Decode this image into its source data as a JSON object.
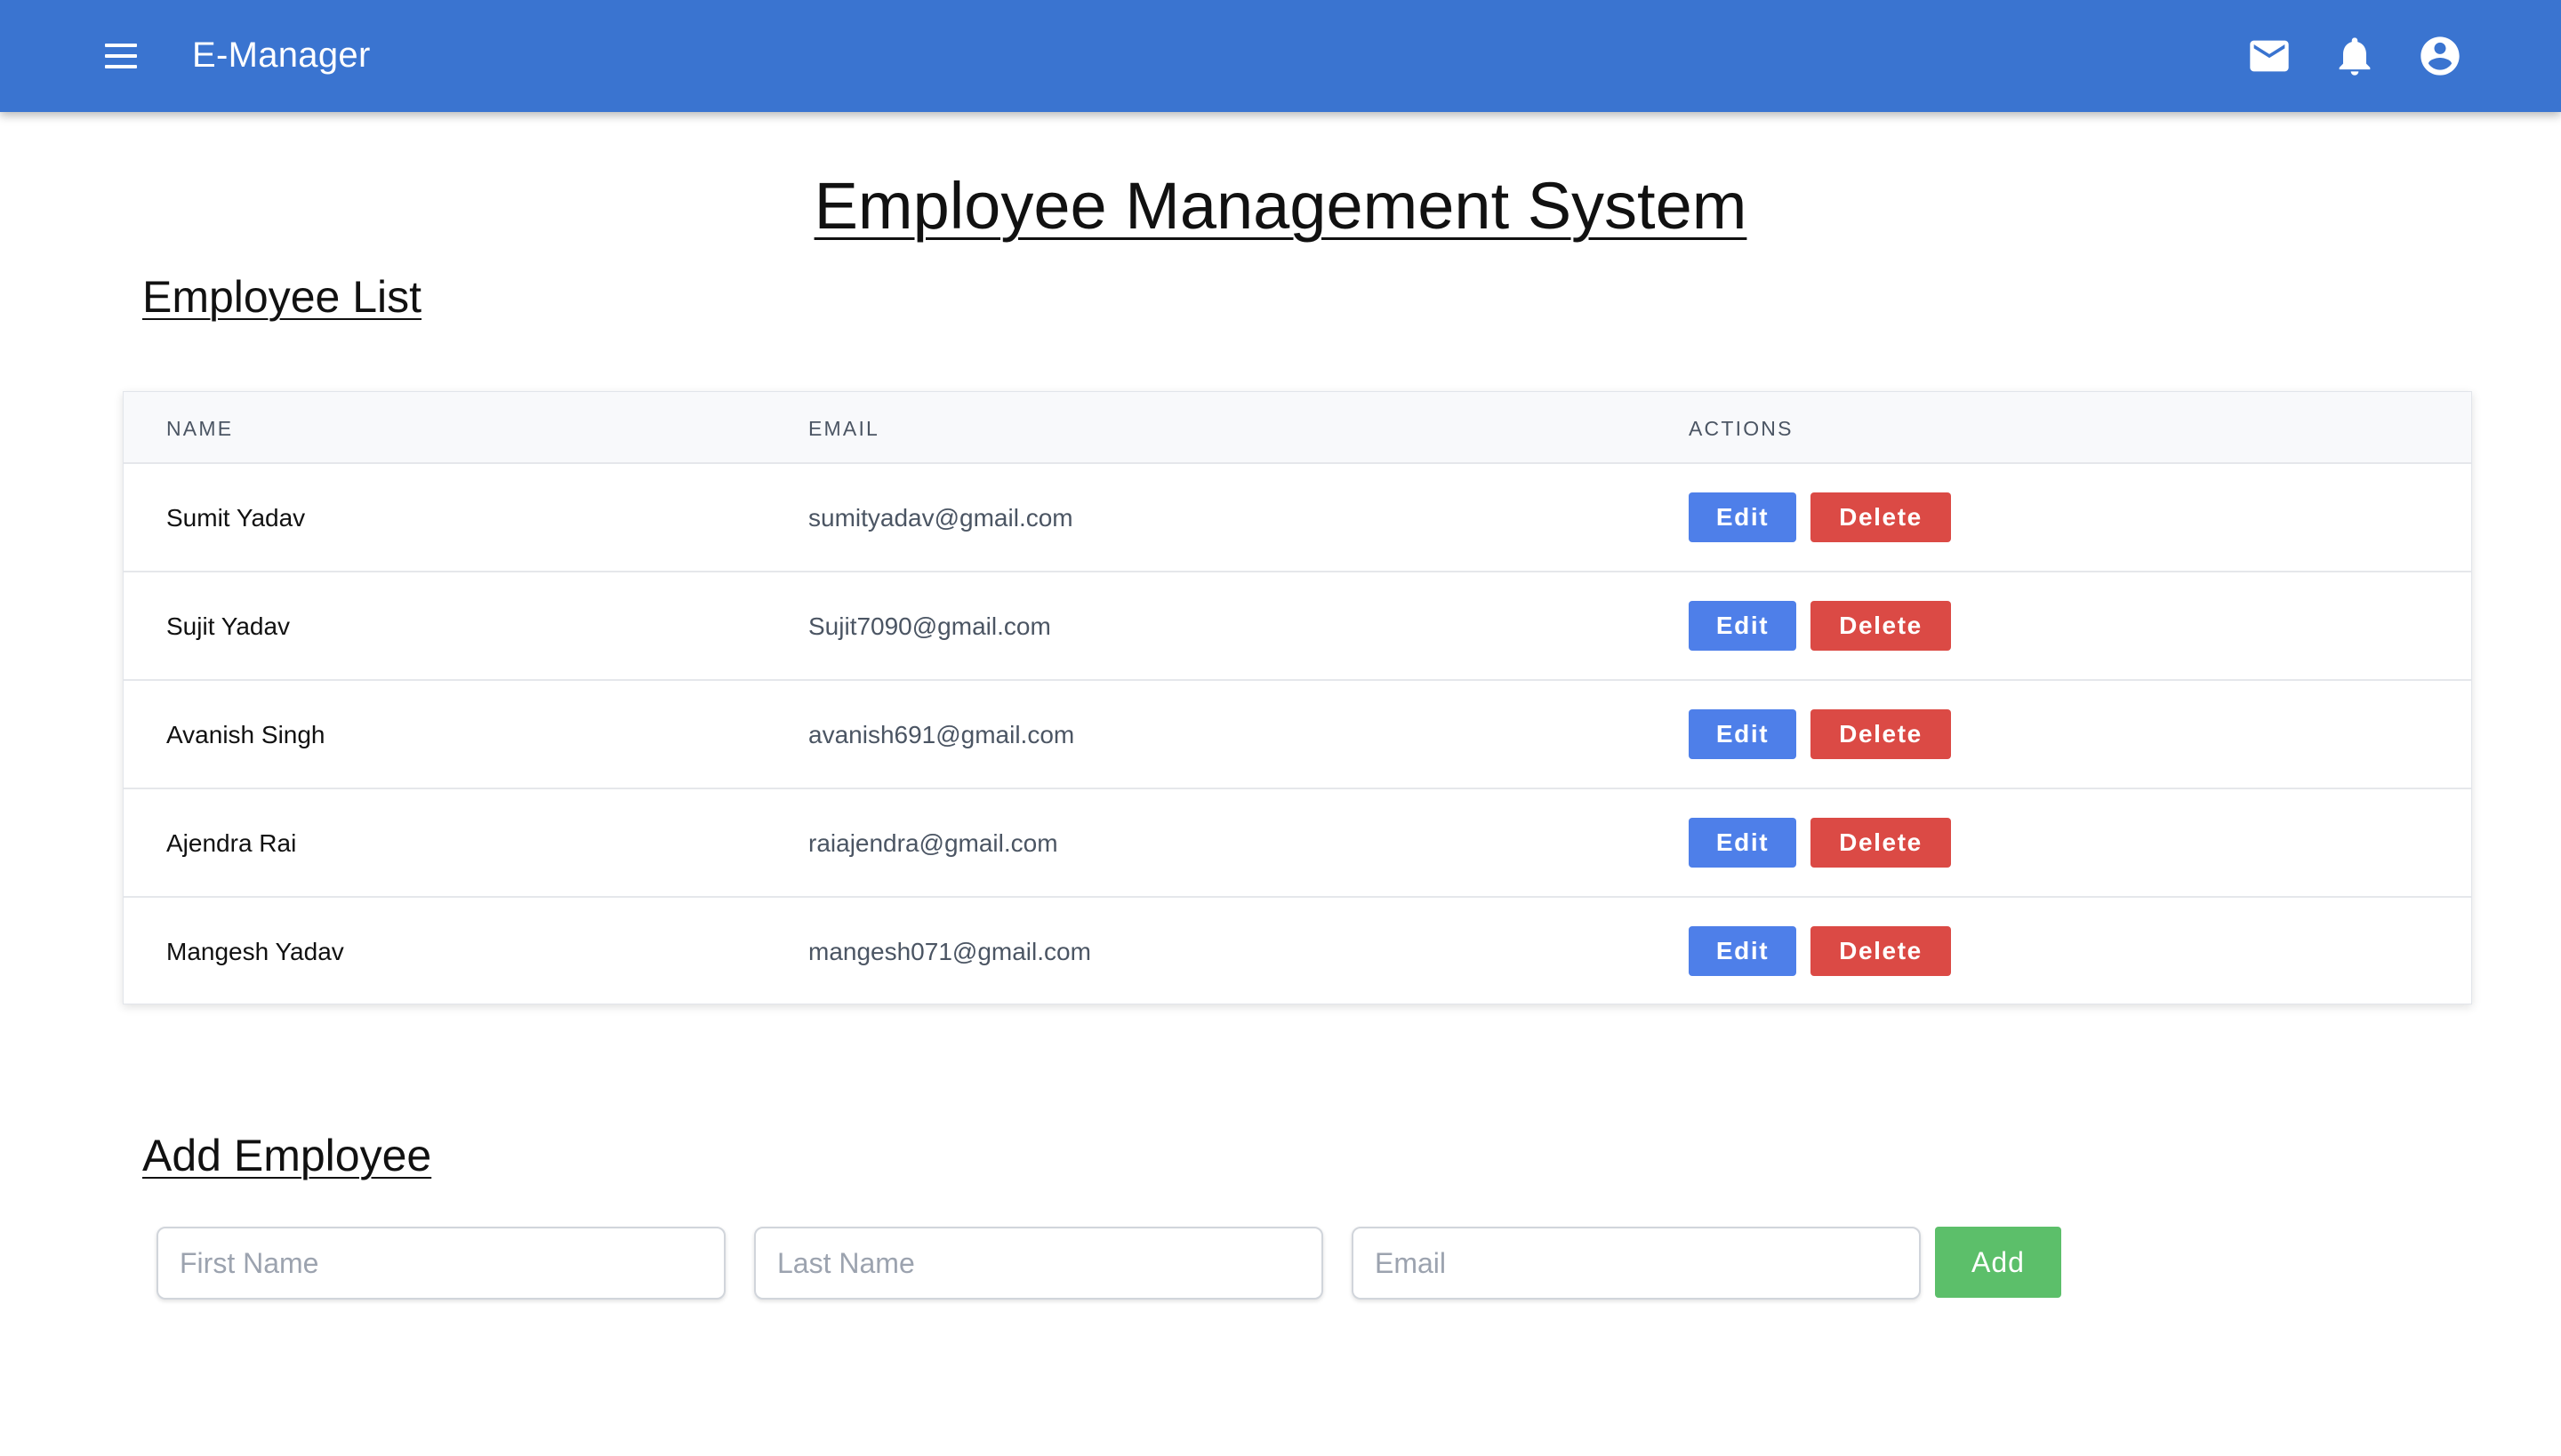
{
  "appbar": {
    "title": "E-Manager",
    "color": "#3a74d0",
    "icons": [
      "menu-icon",
      "mail-icon",
      "bell-icon",
      "account-circle-icon"
    ]
  },
  "page": {
    "title": "Employee Management System"
  },
  "employee_list": {
    "title": "Employee List",
    "columns": [
      "NAME",
      "EMAIL",
      "ACTIONS"
    ],
    "rows": [
      {
        "name": "Sumit Yadav",
        "email": "sumityadav@gmail.com",
        "edit": "Edit",
        "delete": "Delete"
      },
      {
        "name": "Sujit Yadav",
        "email": "Sujit7090@gmail.com",
        "edit": "Edit",
        "delete": "Delete"
      },
      {
        "name": "Avanish Singh",
        "email": "avanish691@gmail.com",
        "edit": "Edit",
        "delete": "Delete"
      },
      {
        "name": "Ajendra Rai",
        "email": "raiajendra@gmail.com",
        "edit": "Edit",
        "delete": "Delete"
      },
      {
        "name": "Mangesh Yadav",
        "email": "mangesh071@gmail.com",
        "edit": "Edit",
        "delete": "Delete"
      }
    ],
    "colors": {
      "edit": "#4e7fe9",
      "delete": "#db4a45"
    }
  },
  "add_employee": {
    "title": "Add Employee",
    "first_name": {
      "value": "",
      "placeholder": "First Name"
    },
    "last_name": {
      "value": "",
      "placeholder": "Last Name"
    },
    "email": {
      "value": "",
      "placeholder": "Email"
    },
    "add_label": "Add",
    "add_color": "#5cbf6a"
  }
}
